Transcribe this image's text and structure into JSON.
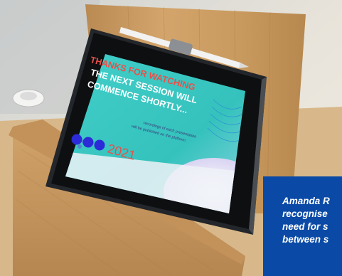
{
  "scene": {
    "description_colors": {
      "bamboo": "#c99a5e",
      "screen_teal": "#3ec9c4",
      "screen_text_red": "#e8504a",
      "screen_text_white": "#ffffff",
      "dot_blue": "#2b2bd8",
      "caption_bg": "#0a4aa6"
    }
  },
  "slide": {
    "line1": "THANKS FOR WATCHING",
    "line2": "THE NEXT SESSION WILL",
    "line3": "COMMENCE SHORTLY...",
    "note_line1": "recordings of each presentation",
    "note_line2": "will be published on the platform",
    "year": "2021"
  },
  "caption": {
    "text": "Amanda R\nrecognise\nneed for s\nbetween s"
  }
}
